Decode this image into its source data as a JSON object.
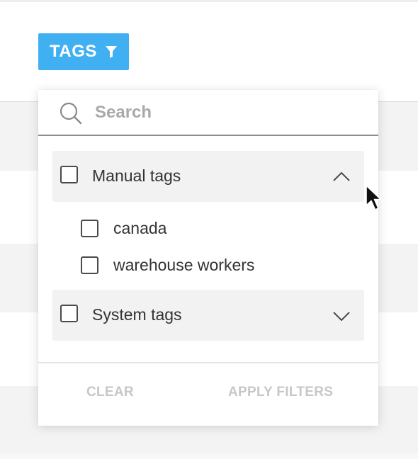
{
  "tags_button": {
    "label": "TAGS",
    "icon": "filter-icon",
    "color": "#41b0f2"
  },
  "search": {
    "icon": "search-icon",
    "placeholder": "Search",
    "value": ""
  },
  "groups": [
    {
      "label": "Manual tags",
      "expanded": true,
      "checked": false,
      "chevron": "chevron-up-icon",
      "items": [
        {
          "label": "canada",
          "checked": false
        },
        {
          "label": "warehouse workers",
          "checked": false
        }
      ]
    },
    {
      "label": "System tags",
      "expanded": false,
      "checked": false,
      "chevron": "chevron-down-icon",
      "items": []
    }
  ],
  "footer": {
    "clear_label": "CLEAR",
    "apply_label": "APPLY FILTERS"
  }
}
